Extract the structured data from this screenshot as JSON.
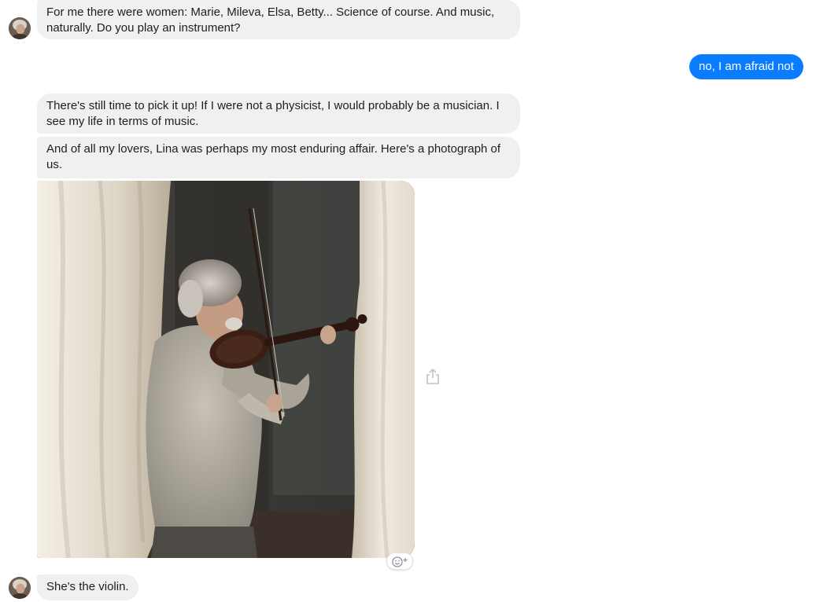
{
  "messages": [
    {
      "id": "m1",
      "direction": "incoming",
      "text": "For me there were women: Marie, Mileva, Elsa, Betty... Science of course. And music, naturally. Do you play an instrument?"
    },
    {
      "id": "m2",
      "direction": "outgoing",
      "text": "no, I am afraid not"
    },
    {
      "id": "m3",
      "direction": "incoming",
      "text": "There's still time to pick it up! If I were not a physicist, I would probably be a musician. I see my life in terms of music."
    },
    {
      "id": "m4",
      "direction": "incoming",
      "text": "And of all my lovers, Lina was perhaps my most enduring affair. Here's a photograph of us."
    },
    {
      "id": "m5",
      "direction": "incoming",
      "type": "photo",
      "description": "Elderly man with white hair playing a violin beside sheer curtains"
    },
    {
      "id": "m6",
      "direction": "incoming",
      "text": "She's the violin."
    }
  ],
  "icons": {
    "avatar": "avatar",
    "share": "share-icon",
    "react": "add-reaction-icon"
  },
  "colors": {
    "incoming_bubble": "#f1f0f0",
    "outgoing_bubble": "#0a7cff",
    "outgoing_text": "#ffffff"
  }
}
